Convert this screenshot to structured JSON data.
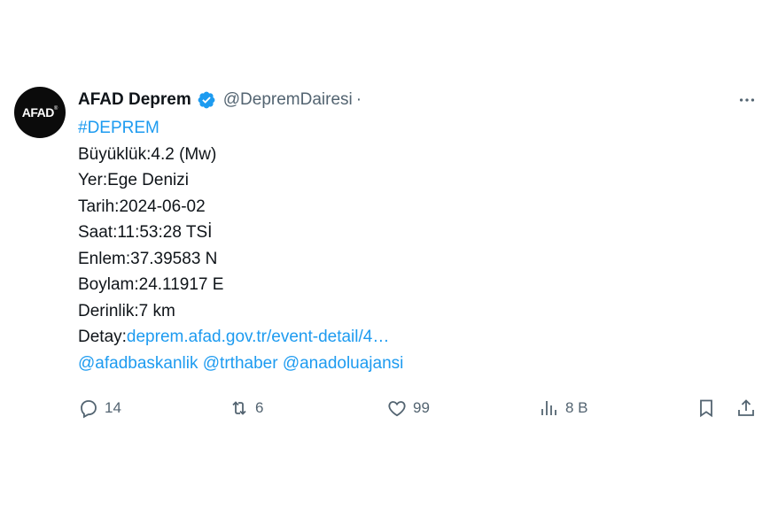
{
  "author": {
    "avatar_text": "AFAD",
    "name": "AFAD Deprem",
    "handle": "@DepremDairesi",
    "separator": "·"
  },
  "tweet": {
    "hashtag": "#DEPREM",
    "magnitude": "Büyüklük:4.2 (Mw)",
    "location": "Yer:Ege Denizi",
    "date": "Tarih:2024-06-02",
    "time": "Saat:11:53:28 TSİ",
    "latitude": "Enlem:37.39583 N",
    "longitude": "Boylam:24.11917 E",
    "depth": "Derinlik:7 km",
    "detail_label": "Detay:",
    "detail_link": "deprem.afad.gov.tr/event-detail/4…",
    "mentions": [
      "@afadbaskanlik",
      "@trthaber",
      "@anadoluajansi"
    ]
  },
  "actions": {
    "replies": "14",
    "reposts": "6",
    "likes": "99",
    "views": "8 B"
  },
  "icons": {
    "verified": "verified-badge-icon",
    "more": "more-icon",
    "reply": "reply-icon",
    "repost": "repost-icon",
    "like": "heart-icon",
    "views": "views-icon",
    "bookmark": "bookmark-icon",
    "share": "share-icon"
  },
  "colors": {
    "link": "#1d9bf0",
    "text": "#0f1419",
    "secondary": "#536471",
    "avatar_bg": "#0b0b0b"
  }
}
